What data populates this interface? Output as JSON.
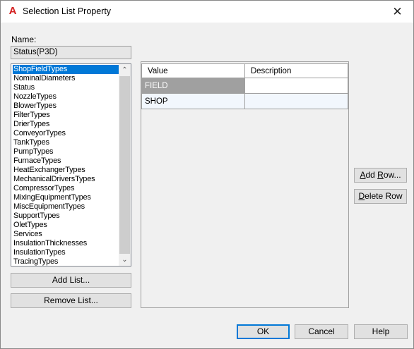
{
  "window": {
    "title": "Selection List Property",
    "close_glyph": "✕",
    "app_icon_glyph": "A"
  },
  "name": {
    "label": "Name:",
    "value": "Status(P3D)"
  },
  "lists": {
    "items": [
      "ShopFieldTypes",
      "NominalDiameters",
      "Status",
      "NozzleTypes",
      "BlowerTypes",
      "FilterTypes",
      "DrierTypes",
      "ConveyorTypes",
      "TankTypes",
      "PumpTypes",
      "FurnaceTypes",
      "HeatExchangerTypes",
      "MechanicalDriversTypes",
      "CompressorTypes",
      "MixingEquipmentTypes",
      "MiscEquipmentTypes",
      "SupportTypes",
      "OletTypes",
      "Services",
      "InsulationThicknesses",
      "InsulationTypes",
      "TracingTypes"
    ],
    "selected": "ShopFieldTypes",
    "scroll_up_glyph": "⌃",
    "scroll_down_glyph": "⌄"
  },
  "list_buttons": {
    "add": "Add List...",
    "remove": "Remove List..."
  },
  "grid": {
    "headers": {
      "value": "Value",
      "description": "Description"
    },
    "rows": [
      {
        "value": "FIELD",
        "description": ""
      },
      {
        "value": "SHOP",
        "description": ""
      }
    ]
  },
  "row_buttons": {
    "add_underline": "A",
    "add_rest": "dd ",
    "add_underline2": "R",
    "add_rest2": "ow...",
    "delete_underline": "D",
    "delete_rest": "elete Row"
  },
  "footer": {
    "ok": "OK",
    "cancel": "Cancel",
    "help": "Help"
  },
  "colors": {
    "selection": "#0078d7",
    "grid_selected": "#a0a0a0",
    "app_icon": "#d32020"
  }
}
